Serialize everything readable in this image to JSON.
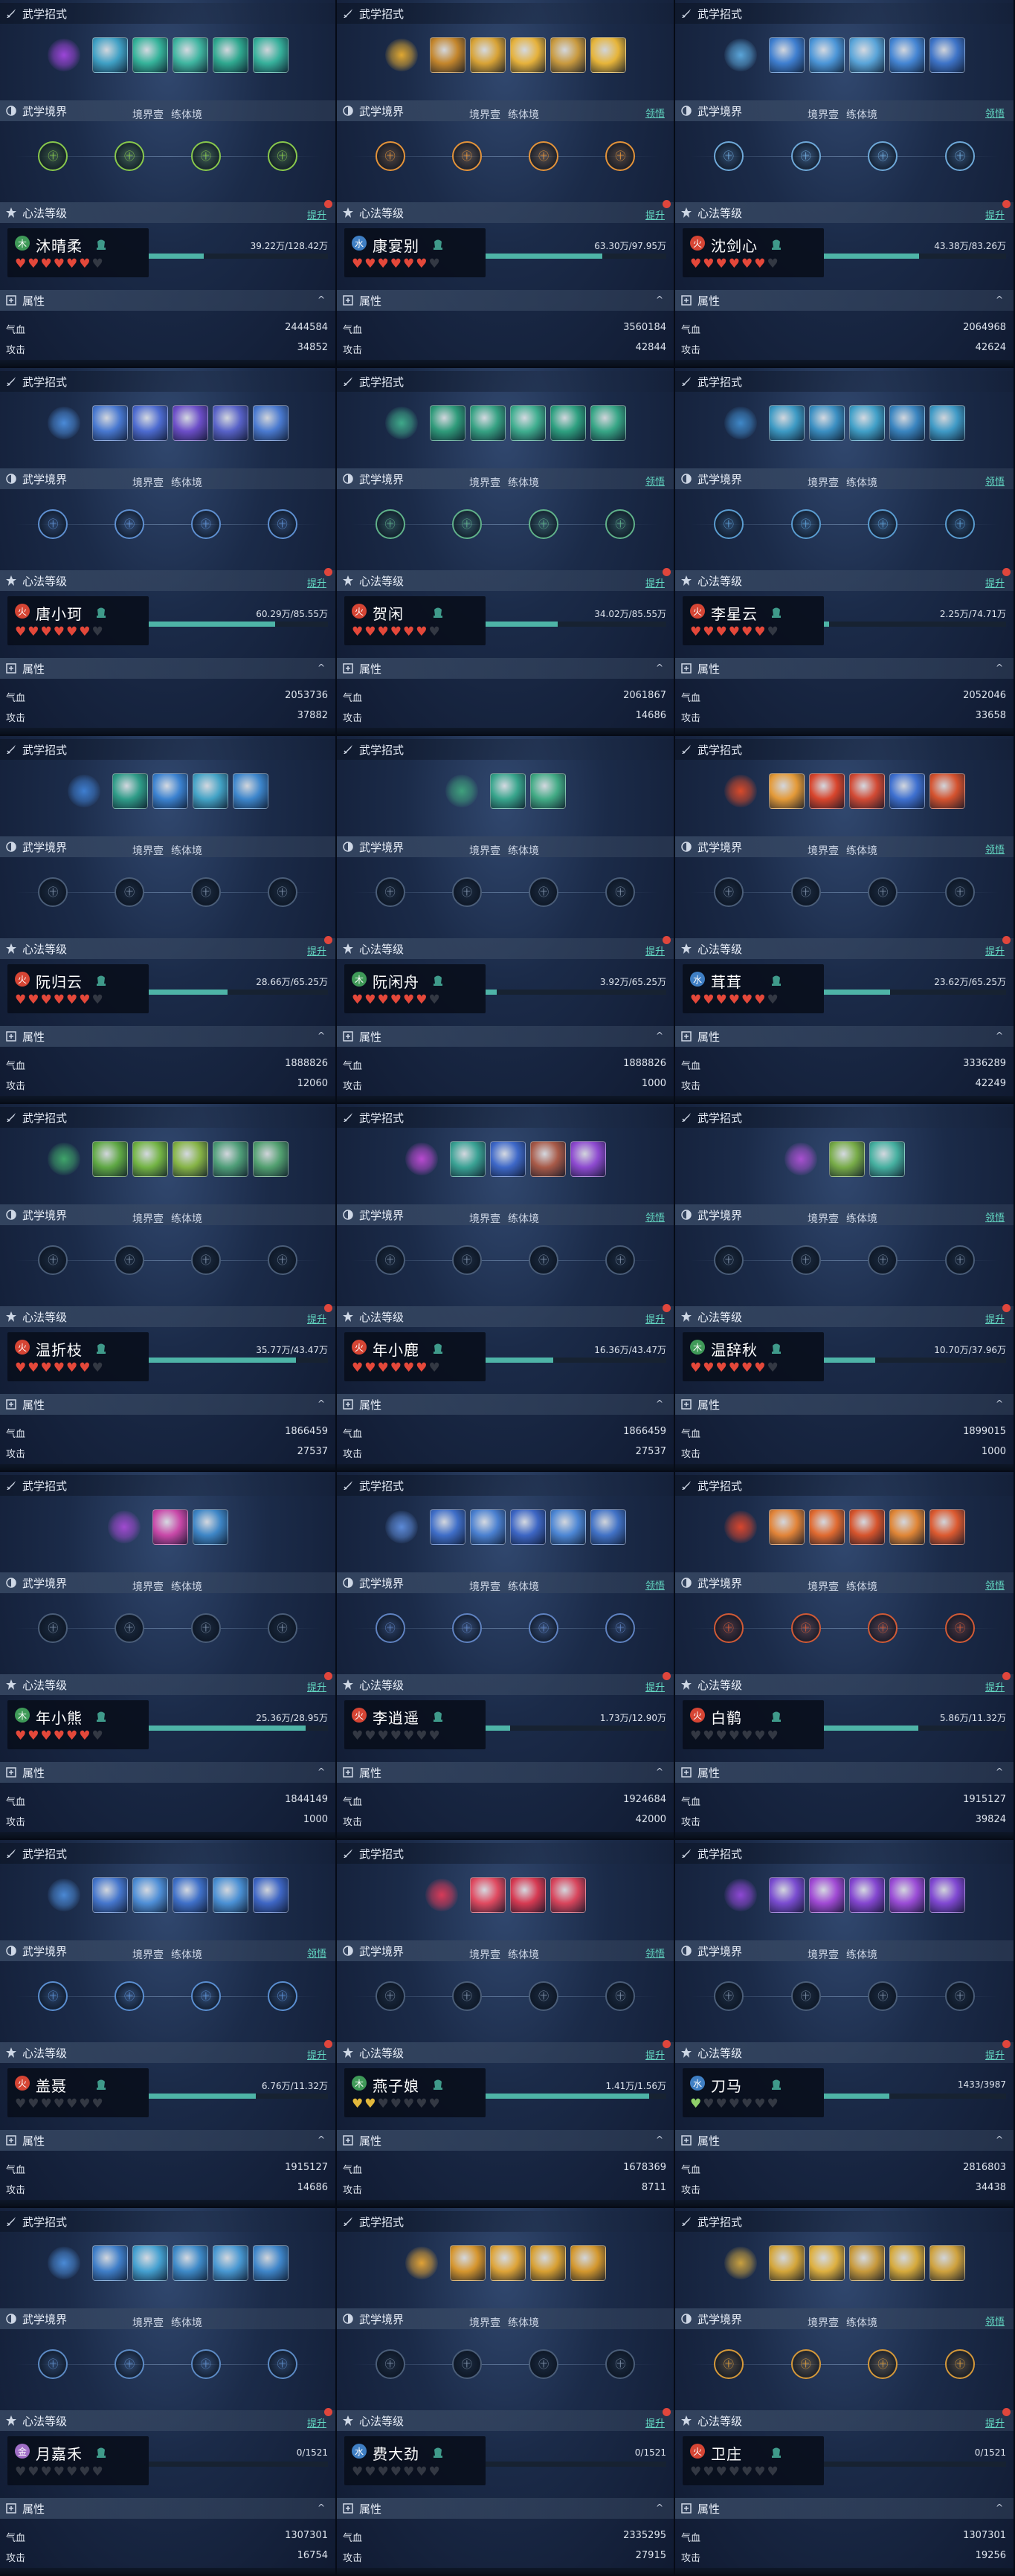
{
  "labels": {
    "skills_header": "武学招式",
    "realm_header": "武学境界",
    "realm_1": "境界壹",
    "realm_2": "练体境",
    "realm_action": "领悟",
    "mind_header": "心法等级",
    "mind_action": "提升",
    "attr_header": "属性",
    "hp_label": "气血",
    "atk_label": "攻击",
    "node_glyph": "㊉",
    "collapse_glyph": "^"
  },
  "element_colors": {
    "fire": "#d64534",
    "wood": "#3f9a58",
    "water": "#3f7fc4",
    "metal": "#a06ec6"
  },
  "cards": [
    {
      "name": "沐晴柔",
      "element_glyph": "木",
      "element": "wood",
      "hearts_filled": 6,
      "hearts_total": 7,
      "heart_color": "#e4483a",
      "progress": "39.22万/128.42万",
      "ratio": 0.305,
      "hp": "2444584",
      "atk": "34852",
      "skills": [
        "#9b45d8",
        "#3fa0c4",
        "#35b39a",
        "#3fb5a0",
        "#2fa88f",
        "#36b09b"
      ],
      "nodes_active": true,
      "node_color": "#88c84c",
      "has_action": false
    },
    {
      "name": "康宴别",
      "element_glyph": "水",
      "element": "water",
      "hearts_filled": 6,
      "hearts_total": 7,
      "heart_color": "#e4483a",
      "progress": "63.30万/97.95万",
      "ratio": 0.646,
      "hp": "3560184",
      "atk": "42844",
      "skills": [
        "#e0a831",
        "#c4862c",
        "#d8a336",
        "#e6b23c",
        "#c99a3f",
        "#e7b53a"
      ],
      "nodes_active": true,
      "node_color": "#e3933a",
      "has_action": true
    },
    {
      "name": "沈剑心",
      "element_glyph": "火",
      "element": "fire",
      "hearts_filled": 6,
      "hearts_total": 7,
      "heart_color": "#e4483a",
      "progress": "43.38万/83.26万",
      "ratio": 0.521,
      "hp": "2064968",
      "atk": "42624",
      "skills": [
        "#5aa5d9",
        "#3f7fd0",
        "#4c96d8",
        "#5aa5d9",
        "#4586d4",
        "#3e74c8"
      ],
      "nodes_active": true,
      "node_color": "#6ea8d8",
      "has_action": true
    },
    {
      "name": "唐小珂",
      "element_glyph": "火",
      "element": "fire",
      "hearts_filled": 6,
      "hearts_total": 7,
      "heart_color": "#e4483a",
      "progress": "60.29万/85.55万",
      "ratio": 0.705,
      "hp": "2053736",
      "atk": "37882",
      "skills": [
        "#4a8ad8",
        "#4878d0",
        "#4d6bd0",
        "#6c4ec8",
        "#5862c8",
        "#4a7ad0"
      ],
      "nodes_active": true,
      "node_color": "#5e8fd0",
      "has_action": false
    },
    {
      "name": "贺闲",
      "element_glyph": "火",
      "element": "fire",
      "hearts_filled": 6,
      "hearts_total": 7,
      "heart_color": "#e4483a",
      "progress": "34.02万/85.55万",
      "ratio": 0.398,
      "hp": "2061867",
      "atk": "14686",
      "skills": [
        "#3fa98a",
        "#2f9b7a",
        "#36a283",
        "#3fae8f",
        "#2ea080",
        "#37a686"
      ],
      "nodes_active": true,
      "node_color": "#60b18a",
      "has_action": true
    },
    {
      "name": "李星云",
      "element_glyph": "火",
      "element": "fire",
      "hearts_filled": 6,
      "hearts_total": 7,
      "heart_color": "#e4483a",
      "progress": "2.25万/74.71万",
      "ratio": 0.03,
      "hp": "2052046",
      "atk": "33658",
      "skills": [
        "#3f88c8",
        "#3d9ac4",
        "#3b8fc2",
        "#41a0c8",
        "#3a85c0",
        "#3f9ac6"
      ],
      "nodes_active": true,
      "node_color": "#5a9cd0",
      "has_action": true
    },
    {
      "name": "阮归云",
      "element_glyph": "火",
      "element": "fire",
      "hearts_filled": 6,
      "hearts_total": 7,
      "heart_color": "#e4483a",
      "progress": "28.66万/65.25万",
      "ratio": 0.439,
      "hp": "1888826",
      "atk": "12060",
      "skills": [
        "#3e7ed0",
        "#2f9c88",
        "#3b82d0",
        "#43a3c6",
        "#3d86cc"
      ],
      "nodes_active": false,
      "node_color": "#7d8ea5",
      "has_action": false
    },
    {
      "name": "阮闲舟",
      "element_glyph": "木",
      "element": "wood",
      "hearts_filled": 6,
      "hearts_total": 7,
      "heart_color": "#e4483a",
      "progress": "3.92万/65.25万",
      "ratio": 0.06,
      "hp": "1888826",
      "atk": "1000",
      "skills": [
        "#3fa07c",
        "#38a58c",
        "#42ab85"
      ],
      "nodes_active": false,
      "node_color": "#7d8ea5",
      "has_action": false
    },
    {
      "name": "茸茸",
      "element_glyph": "水",
      "element": "water",
      "hearts_filled": 6,
      "hearts_total": 7,
      "heart_color": "#e4483a",
      "progress": "23.62万/65.25万",
      "ratio": 0.362,
      "hp": "3336289",
      "atk": "42249",
      "skills": [
        "#d84a2a",
        "#e49a38",
        "#d8452c",
        "#d24a34",
        "#3e70d0",
        "#d4522e"
      ],
      "nodes_active": false,
      "node_color": "#7d8ea5",
      "has_action": true
    },
    {
      "name": "温折枝",
      "element_glyph": "火",
      "element": "fire",
      "hearts_filled": 6,
      "hearts_total": 7,
      "heart_color": "#e4483a",
      "progress": "35.77万/43.47万",
      "ratio": 0.823,
      "hp": "1866459",
      "atk": "27537",
      "skills": [
        "#3fa46a",
        "#5fa844",
        "#73b444",
        "#86b446",
        "#4f9e78",
        "#52a070"
      ],
      "nodes_active": false,
      "node_color": "#7d8ea5",
      "has_action": false
    },
    {
      "name": "年小鹿",
      "element_glyph": "火",
      "element": "fire",
      "hearts_filled": 6,
      "hearts_total": 7,
      "heart_color": "#e4483a",
      "progress": "16.36万/43.47万",
      "ratio": 0.376,
      "hp": "1866459",
      "atk": "27537",
      "skills": [
        "#b84ad0",
        "#3aa294",
        "#3e68c8",
        "#a85a48",
        "#8e4ad0"
      ],
      "nodes_active": false,
      "node_color": "#7d8ea5",
      "has_action": true
    },
    {
      "name": "温辞秋",
      "element_glyph": "木",
      "element": "wood",
      "hearts_filled": 6,
      "hearts_total": 7,
      "heart_color": "#e4483a",
      "progress": "10.70万/37.96万",
      "ratio": 0.282,
      "hp": "1899015",
      "atk": "1000",
      "skills": [
        "#a850d0",
        "#78ac48",
        "#46b0a0"
      ],
      "nodes_active": false,
      "node_color": "#7d8ea5",
      "has_action": true
    },
    {
      "name": "年小熊",
      "element_glyph": "木",
      "element": "wood",
      "hearts_filled": 6,
      "hearts_total": 7,
      "heart_color": "#e4483a",
      "progress": "25.36万/28.95万",
      "ratio": 0.876,
      "hp": "1844149",
      "atk": "1000",
      "skills": [
        "#a04ad0",
        "#c848a8",
        "#3e86c6"
      ],
      "nodes_active": false,
      "node_color": "#7d8ea5",
      "has_action": false
    },
    {
      "name": "李逍遥",
      "element_glyph": "火",
      "element": "fire",
      "hearts_filled": 0,
      "hearts_total": 7,
      "heart_color": "#e4483a",
      "progress": "1.73万/12.90万",
      "ratio": 0.134,
      "hp": "1924684",
      "atk": "42000",
      "skills": [
        "#5c8ad8",
        "#3f6ec8",
        "#4a80d0",
        "#3d66c4",
        "#4c86d4",
        "#4172c6"
      ],
      "nodes_active": true,
      "node_color": "#5f82c0",
      "has_action": true
    },
    {
      "name": "白鹡",
      "element_glyph": "火",
      "element": "fire",
      "hearts_filled": 0,
      "hearts_total": 7,
      "heart_color": "#e4483a",
      "progress": "5.86万/11.32万",
      "ratio": 0.518,
      "hp": "1915127",
      "atk": "39824",
      "skills": [
        "#d8462e",
        "#e28438",
        "#e06a30",
        "#d6542c",
        "#e08636",
        "#dc5a30"
      ],
      "nodes_active": true,
      "node_color": "#d05a36",
      "has_action": true
    },
    {
      "name": "盖聂",
      "element_glyph": "火",
      "element": "fire",
      "hearts_filled": 0,
      "hearts_total": 7,
      "heart_color": "#e4483a",
      "progress": "6.76万/11.32万",
      "ratio": 0.597,
      "hp": "1915127",
      "atk": "14686",
      "skills": [
        "#4a88d4",
        "#4576cc",
        "#4e8ed6",
        "#3f70c8",
        "#4a90d4",
        "#3e66c4"
      ],
      "nodes_active": true,
      "node_color": "#5a8ed0",
      "has_action": true
    },
    {
      "name": "燕子娘",
      "element_glyph": "木",
      "element": "wood",
      "hearts_filled": 2,
      "hearts_total": 7,
      "heart_color": "#e2b83c",
      "progress": "1.41万/1.56万",
      "ratio": 0.904,
      "hp": "1678369",
      "atk": "8711",
      "skills": [
        "#d83a58",
        "#e04a60",
        "#d63a52",
        "#d8455c"
      ],
      "nodes_active": false,
      "node_color": "#7d8ea5",
      "has_action": true
    },
    {
      "name": "刀马",
      "element_glyph": "水",
      "element": "water",
      "hearts_filled": 1,
      "hearts_total": 7,
      "heart_color": "#8fcf6a",
      "progress": "1433/3987",
      "ratio": 0.359,
      "hp": "2816803",
      "atk": "34438",
      "skills": [
        "#8e48d4",
        "#7a4cd0",
        "#a04ad4",
        "#8446d0",
        "#9a4cd6",
        "#8048d2"
      ],
      "nodes_active": false,
      "node_color": "#7d8ea5",
      "has_action": false
    },
    {
      "name": "月嘉禾",
      "element_glyph": "金",
      "element": "metal",
      "hearts_filled": 0,
      "hearts_total": 7,
      "heart_color": "#e4483a",
      "progress": "0/1521",
      "ratio": 0,
      "hp": "1307301",
      "atk": "16754",
      "skills": [
        "#4a8ad6",
        "#3f7ec8",
        "#44a0d0",
        "#3e8ac8",
        "#4898d2",
        "#3f86ca"
      ],
      "nodes_active": true,
      "node_color": "#5c8ac4",
      "has_action": false
    },
    {
      "name": "费大劲",
      "element_glyph": "水",
      "element": "water",
      "hearts_filled": 0,
      "hearts_total": 7,
      "heart_color": "#e4483a",
      "progress": "0/1521",
      "ratio": 0,
      "hp": "2335295",
      "atk": "27915",
      "skills": [
        "#e0a236",
        "#d6962e",
        "#dea438",
        "#d8a032",
        "#d4982e"
      ],
      "nodes_active": false,
      "node_color": "#7d8ea5",
      "has_action": false
    },
    {
      "name": "卫庄",
      "element_glyph": "火",
      "element": "fire",
      "hearts_filled": 0,
      "hearts_total": 7,
      "heart_color": "#e4483a",
      "progress": "0/1521",
      "ratio": 0,
      "hp": "1307301",
      "atk": "19256",
      "skills": [
        "#c8a040",
        "#d4a63a",
        "#deb040",
        "#c89a3c",
        "#d6aa3c",
        "#cfa23e"
      ],
      "nodes_active": true,
      "node_color": "#d4983a",
      "has_action": true
    }
  ]
}
